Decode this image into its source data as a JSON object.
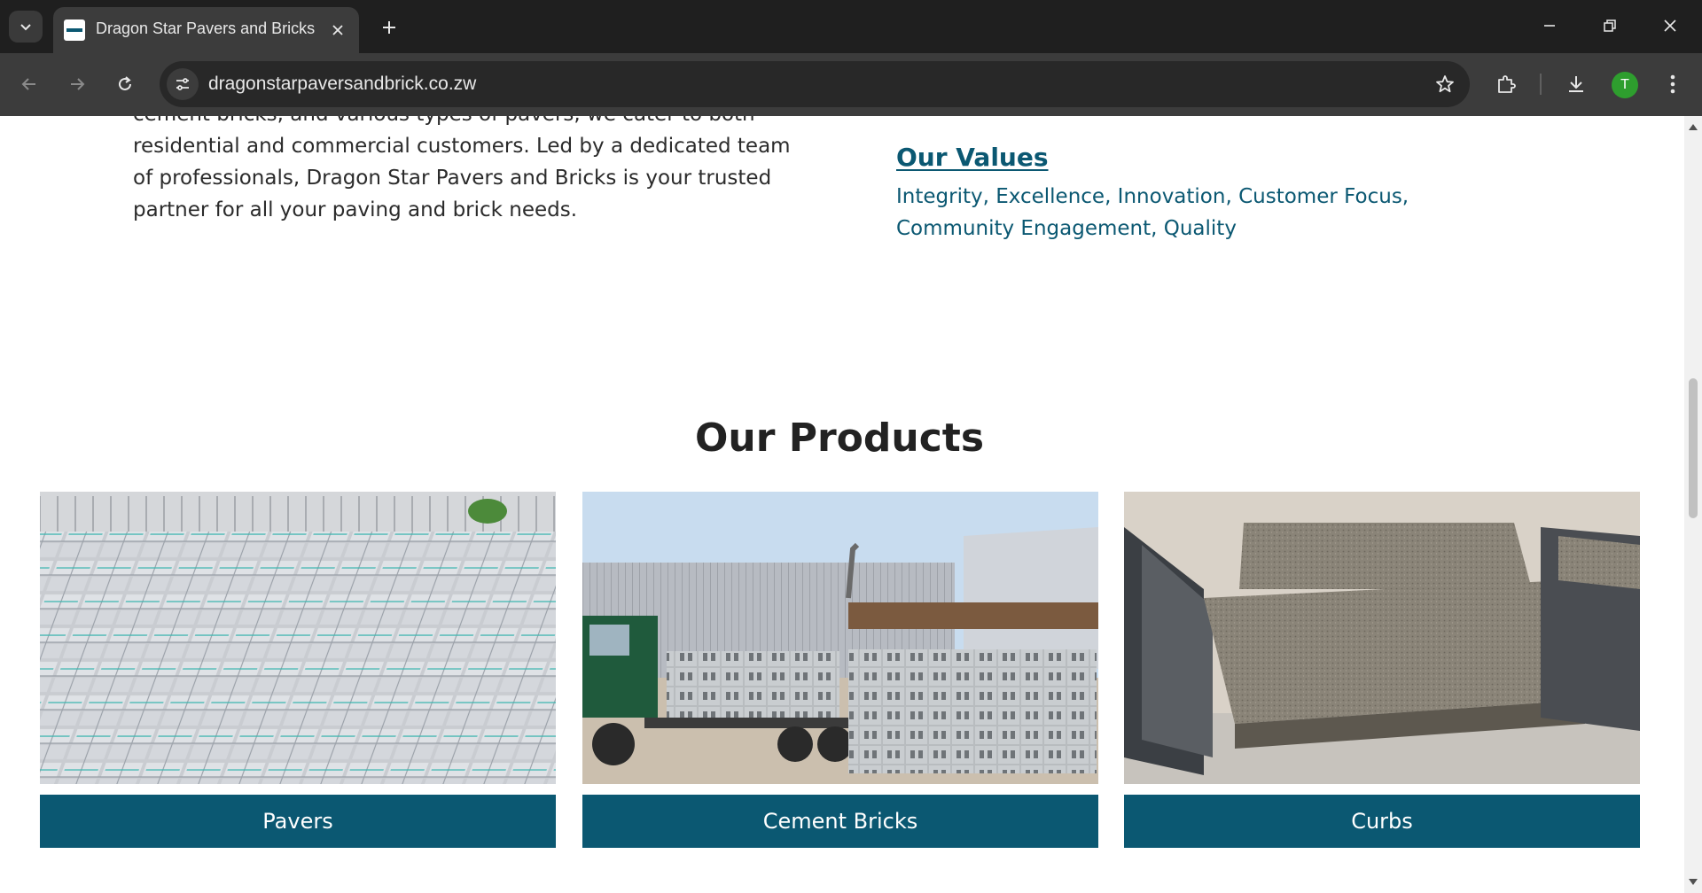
{
  "browser": {
    "tab_title": "Dragon Star Pavers and Bricks",
    "url": "dragonstarpaversandbrick.co.zw",
    "profile_initial": "T"
  },
  "about": {
    "text": "cement bricks, and various types of pavers, we cater to both residential and commercial customers. Led by a dedicated team of professionals, Dragon Star Pavers and Bricks is your trusted partner for all your paving and brick needs."
  },
  "values": {
    "title": "Our Values",
    "text": "Integrity, Excellence, Innovation, Customer Focus, Community Engagement, Quality"
  },
  "products": {
    "heading": "Our Products",
    "items": [
      {
        "label": "Pavers"
      },
      {
        "label": "Cement Bricks"
      },
      {
        "label": "Curbs"
      }
    ]
  },
  "colors": {
    "brand": "#0b5872",
    "chrome_dark": "#1f1f1f",
    "chrome_toolbar": "#3c3c3c"
  }
}
